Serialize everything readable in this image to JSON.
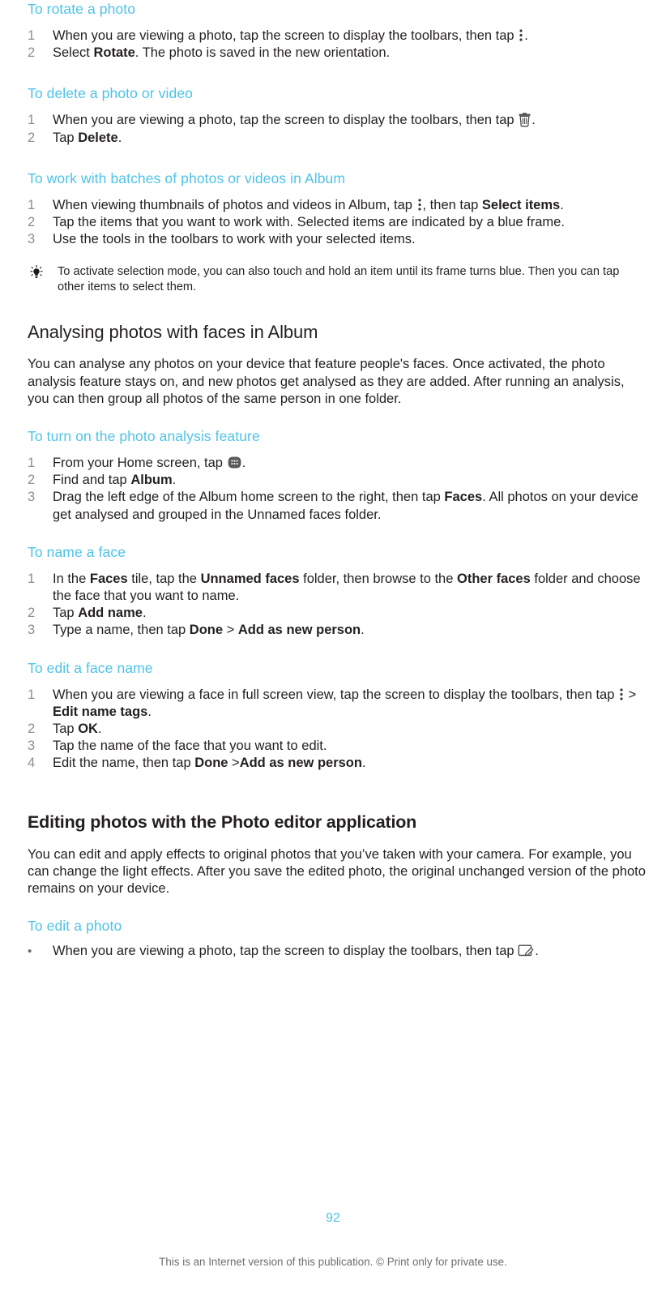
{
  "document": {
    "page_number": "92",
    "footer_note": "This is an Internet version of this publication. © Print only for private use."
  },
  "sections": [
    {
      "heading": "To rotate a photo",
      "steps": [
        {
          "num": "1",
          "text_before": "When you are viewing a photo, tap the screen to display the toolbars, then tap ",
          "icon": "overflow-menu-icon",
          "text_after": "."
        },
        {
          "num": "2",
          "text_before": "Select ",
          "bold": "Rotate",
          "text_after": ". The photo is saved in the new orientation."
        }
      ]
    },
    {
      "heading": "To delete a photo or video",
      "steps": [
        {
          "num": "1",
          "text_before": "When you are viewing a photo, tap the screen to display the toolbars, then tap ",
          "icon": "trash-icon",
          "text_after": "."
        },
        {
          "num": "2",
          "text_before": "Tap ",
          "bold": "Delete",
          "text_after": "."
        }
      ]
    },
    {
      "heading": "To work with batches of photos or videos in Album",
      "steps": [
        {
          "num": "1",
          "text_before": "When viewing thumbnails of photos and videos in Album, tap ",
          "icon": "overflow-menu-icon",
          "text_mid": ", then tap ",
          "bold": "Select items",
          "text_after": "."
        },
        {
          "num": "2",
          "text_before": "Tap the items that you want to work with. Selected items are indicated by a blue frame."
        },
        {
          "num": "3",
          "text_before": "Use the tools in the toolbars to work with your selected items."
        }
      ],
      "tip": "To activate selection mode, you can also touch and hold an item until its frame turns blue. Then you can tap other items to select them."
    }
  ],
  "chapter_faces": {
    "title": "Analysing photos with faces in Album",
    "intro": "You can analyse any photos on your device that feature people's faces. Once activated, the photo analysis feature stays on, and new photos get analysed as they are added. After running an analysis, you can then group all photos of the same person in one folder.",
    "sections": [
      {
        "heading": "To turn on the photo analysis feature",
        "steps": [
          {
            "num": "1",
            "text_before": "From your Home screen, tap ",
            "icon": "apps-grid-icon",
            "text_after": "."
          },
          {
            "num": "2",
            "text_before": "Find and tap ",
            "bold": "Album",
            "text_after": "."
          },
          {
            "num": "3",
            "text_before": "Drag the left edge of the Album home screen to the right, then tap ",
            "bold": "Faces",
            "text_after": ". All photos on your device get analysed and grouped in the Unnamed faces folder."
          }
        ]
      },
      {
        "heading": "To name a face",
        "steps": [
          {
            "num": "1",
            "text_before": "In the ",
            "bold": "Faces",
            "text_mid": " tile, tap the ",
            "bold2": "Unnamed faces",
            "text_mid2": " folder, then browse to the ",
            "bold3": "Other faces",
            "text_after": " folder and choose the face that you want to name."
          },
          {
            "num": "2",
            "text_before": "Tap ",
            "bold": "Add name",
            "text_after": "."
          },
          {
            "num": "3",
            "text_before": "Type a name, then tap ",
            "bold": "Done",
            "text_mid": " > ",
            "bold2": "Add as new person",
            "text_after": "."
          }
        ]
      },
      {
        "heading": "To edit a face name",
        "steps": [
          {
            "num": "1",
            "text_before": "When you are viewing a face in full screen view, tap the screen to display the toolbars, then tap ",
            "icon": "overflow-menu-icon",
            "text_mid": " > ",
            "bold": "Edit name tags",
            "text_after": "."
          },
          {
            "num": "2",
            "text_before": "Tap ",
            "bold": "OK",
            "text_after": "."
          },
          {
            "num": "3",
            "text_before": "Tap the name of the face that you want to edit."
          },
          {
            "num": "4",
            "text_before": "Edit the name, then tap ",
            "bold": "Done",
            "text_mid": " >",
            "bold2": "Add as new person",
            "text_after": "."
          }
        ]
      }
    ]
  },
  "chapter_editor": {
    "title": "Editing photos with the Photo editor application",
    "intro": "You can edit and apply effects to original photos that you’ve taken with your camera. For example, you can change the light effects. After you save the edited photo, the original unchanged version of the photo remains on your device.",
    "sections": [
      {
        "heading": "To edit a photo",
        "steps": [
          {
            "num": "•",
            "text_before": "When you are viewing a photo, tap the screen to display the toolbars, then tap ",
            "icon": "photo-edit-icon",
            "text_after": "."
          }
        ]
      }
    ]
  },
  "colors": {
    "heading_accent": "#4ec3e8",
    "body_text": "#231f20",
    "list_number": "#8e8e8e",
    "footer_text": "#6d6e71"
  }
}
